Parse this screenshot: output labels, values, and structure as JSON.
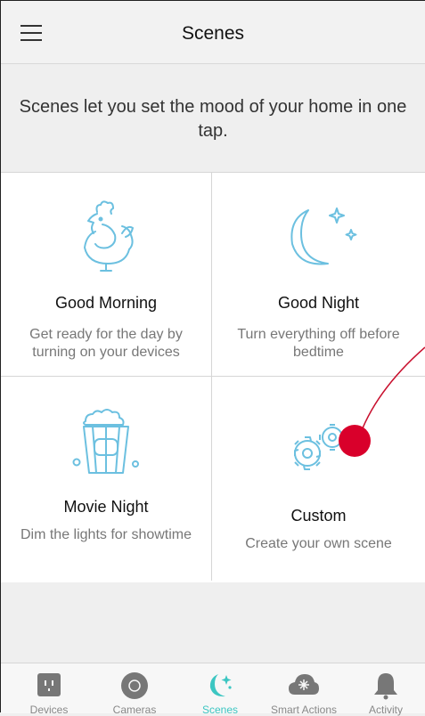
{
  "header": {
    "title": "Scenes",
    "menu_icon": "hamburger-menu-icon"
  },
  "intro": {
    "text": "Scenes let you set the mood of your home in one tap."
  },
  "scenes": [
    {
      "name": "Good Morning",
      "desc": "Get ready for the day by turning on your devices",
      "icon": "rooster-icon"
    },
    {
      "name": "Good Night",
      "desc": "Turn everything off before bedtime",
      "icon": "moon-stars-icon"
    },
    {
      "name": "Movie Night",
      "desc": "Dim the lights for showtime",
      "icon": "popcorn-icon"
    },
    {
      "name": "Custom",
      "desc": "Create your own scene",
      "icon": "gears-icon"
    }
  ],
  "tabs": [
    {
      "label": "Devices",
      "icon": "outlet-icon"
    },
    {
      "label": "Cameras",
      "icon": "camera-lens-icon"
    },
    {
      "label": "Scenes",
      "icon": "scenes-moon-icon",
      "active": true
    },
    {
      "label": "Smart Actions",
      "icon": "cloud-spark-icon"
    },
    {
      "label": "Activity",
      "icon": "bell-icon"
    }
  ],
  "colors": {
    "accent": "#3cc6c2",
    "icon_blue": "#6cc0e0",
    "marker": "#d9002b"
  }
}
